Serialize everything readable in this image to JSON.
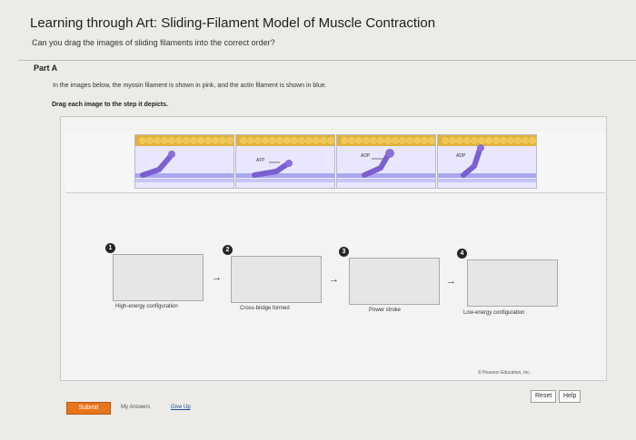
{
  "header": {
    "title": "Learning through Art: Sliding-Filament Model of Muscle Contraction",
    "question": "Can you drag the images of sliding filaments into the correct order?"
  },
  "part": {
    "label": "Part A",
    "instructions": "In the images below, the myosin filament is shown in pink, and the actin filament is shown in blue.",
    "drag_instructions": "Drag each image to the step it depicts."
  },
  "image_bank": {
    "tiles": [
      {
        "label": ""
      },
      {
        "label": "ATP"
      },
      {
        "label": "ADP"
      },
      {
        "label": "ADP"
      }
    ]
  },
  "steps": [
    {
      "number": "1",
      "label": "High-energy configuration"
    },
    {
      "number": "2",
      "label": "Cross-bridge formed"
    },
    {
      "number": "3",
      "label": "Power stroke"
    },
    {
      "number": "4",
      "label": "Low-energy configuration"
    }
  ],
  "arrow_glyph": "→",
  "footer": {
    "copyright": "© Pearson Education, Inc.",
    "reset": "Reset",
    "help": "Help",
    "submit": "Submit",
    "my_answers": "My Answers",
    "give_up": "Give Up"
  },
  "colors": {
    "submit_bg": "#e8751c",
    "myosin": "#8b6fd6",
    "actin": "#e0b23a",
    "membrane": "#a9a7ef"
  }
}
